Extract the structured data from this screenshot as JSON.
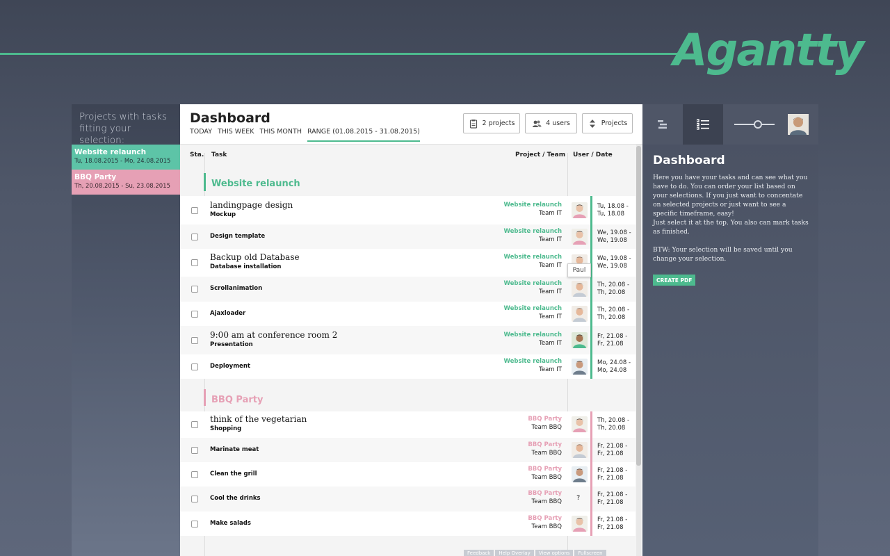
{
  "brand": {
    "logo": "Agantty",
    "color": "#4dba8e"
  },
  "left": {
    "title": "Projects with tasks fitting your selection:",
    "projects": [
      {
        "name": "Website relaunch",
        "range": "Tu, 18.08.2015 - Mo, 24.08.2015",
        "color": "#5dc4a7"
      },
      {
        "name": "BBQ Party",
        "range": "Th, 20.08.2015 - Su, 23.08.2015",
        "color": "#e6a0b5"
      }
    ]
  },
  "header": {
    "title": "Dashboard",
    "filters": [
      "TODAY",
      "THIS WEEK",
      "THIS MONTH",
      "RANGE (01.08.2015 - 31.08.2015)"
    ],
    "buttons": {
      "projects": "2 projects",
      "users": "4 users",
      "sort": "Projects"
    }
  },
  "table": {
    "headers": {
      "status": "Sta.",
      "task": "Task",
      "project": "Project / Team",
      "user": "User / Date"
    },
    "groups": [
      {
        "name": "Website relaunch",
        "color": "#4dba8e",
        "rows": [
          {
            "title": "landingpage design",
            "sub": "Mockup",
            "project": "Website relaunch",
            "team": "Team IT",
            "d1": "Tu, 18.08 -",
            "d2": "Tu, 18.08"
          },
          {
            "title": "",
            "sub": "Design template",
            "project": "Website relaunch",
            "team": "Team IT",
            "d1": "We, 19.08 -",
            "d2": "We, 19.08"
          },
          {
            "title": "Backup old Database",
            "sub": "Database installation",
            "project": "Website relaunch",
            "team": "Team IT",
            "d1": "We, 19.08 -",
            "d2": "We, 19.08"
          },
          {
            "title": "",
            "sub": "Scrollanimation",
            "project": "Website relaunch",
            "team": "Team IT",
            "d1": "Th, 20.08 -",
            "d2": "Th, 20.08"
          },
          {
            "title": "",
            "sub": "Ajaxloader",
            "project": "Website relaunch",
            "team": "Team IT",
            "d1": "Th, 20.08 -",
            "d2": "Th, 20.08"
          },
          {
            "title": "9:00 am at conference room 2",
            "sub": "Presentation",
            "project": "Website relaunch",
            "team": "Team IT",
            "d1": "Fr, 21.08 -",
            "d2": "Fr, 21.08"
          },
          {
            "title": "",
            "sub": "Deployment",
            "project": "Website relaunch",
            "team": "Team IT",
            "d1": "Mo, 24.08 -",
            "d2": "Mo, 24.08"
          }
        ]
      },
      {
        "name": "BBQ Party",
        "color": "#e6a0b5",
        "rows": [
          {
            "title": "think of the vegetarian",
            "sub": "Shopping",
            "project": "BBQ Party",
            "team": "Team BBQ",
            "d1": "Th, 20.08 -",
            "d2": "Th, 20.08"
          },
          {
            "title": "",
            "sub": "Marinate meat",
            "project": "BBQ Party",
            "team": "Team BBQ",
            "d1": "Fr, 21.08 -",
            "d2": "Fr, 21.08"
          },
          {
            "title": "",
            "sub": "Clean the grill",
            "project": "BBQ Party",
            "team": "Team BBQ",
            "d1": "Fr, 21.08 -",
            "d2": "Fr, 21.08"
          },
          {
            "title": "",
            "sub": "Cool the drinks",
            "project": "BBQ Party",
            "team": "Team BBQ",
            "d1": "Fr, 21.08 -",
            "d2": "Fr, 21.08",
            "unassigned": "?"
          },
          {
            "title": "",
            "sub": "Make salads",
            "project": "BBQ Party",
            "team": "Team BBQ",
            "d1": "Fr, 21.08 -",
            "d2": "Fr, 21.08"
          }
        ]
      }
    ],
    "tooltip": "Paul"
  },
  "footer": {
    "links": [
      "Feedback",
      "Help Overlay",
      "View options",
      "Fullscreen"
    ]
  },
  "right": {
    "title": "Dashboard",
    "p1": "Here you have your tasks and can see what you have to do. You can order your list based on your selections. If you just want to concentate on selected projects or just want to see a specific timeframe, easy!",
    "p1b": "Just select it at the top. You also can mark tasks as finished.",
    "p2": "BTW: Your selection will be saved until you change your selection.",
    "pdf_button": "CREATE PDF"
  }
}
